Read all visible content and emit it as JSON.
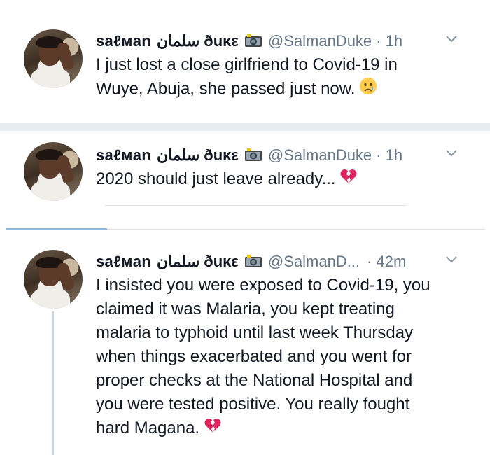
{
  "tweets": [
    {
      "display_name": "saℓмan",
      "arabic_name": "سلمان",
      "surname": "ðuκε",
      "handle": "@SalmanDuke",
      "time": "· 1h",
      "lines": [
        "I just lost a close girlfriend to Covid-19 in",
        "Wuye, Abuja, she passed just now."
      ],
      "emoji": "crying-face"
    },
    {
      "display_name": "saℓмan",
      "arabic_name": "سلمان",
      "surname": "ðuκε",
      "handle": "@SalmanDuke",
      "time": "· 1h",
      "lines": [
        "2020 should just leave already..."
      ],
      "emoji": "broken-heart"
    },
    {
      "display_name": "saℓмan",
      "arabic_name": "سلمان",
      "surname": "ðuκε",
      "handle": "@SalmanD...",
      "time": "· 42m",
      "lines": [
        "I insisted you were exposed to Covid-19, you",
        "claimed it was Malaria, you kept treating",
        "malaria to typhoid until last week Thursday",
        "when things exacerbated and you went for",
        "proper checks at the National Hospital and",
        "you were tested positive. You really fought",
        "hard Magana."
      ],
      "emoji": "broken-heart"
    }
  ],
  "icons": {
    "camera": "camera-with-flash-icon",
    "chevron": "chevron-down-icon"
  },
  "colors": {
    "text": "#141823",
    "secondary": "#657786",
    "separator": "#e6ecf0",
    "accent_line": "#8fb8de",
    "broken_heart": "#e0245e",
    "crying_face": "#ffcc4d"
  }
}
